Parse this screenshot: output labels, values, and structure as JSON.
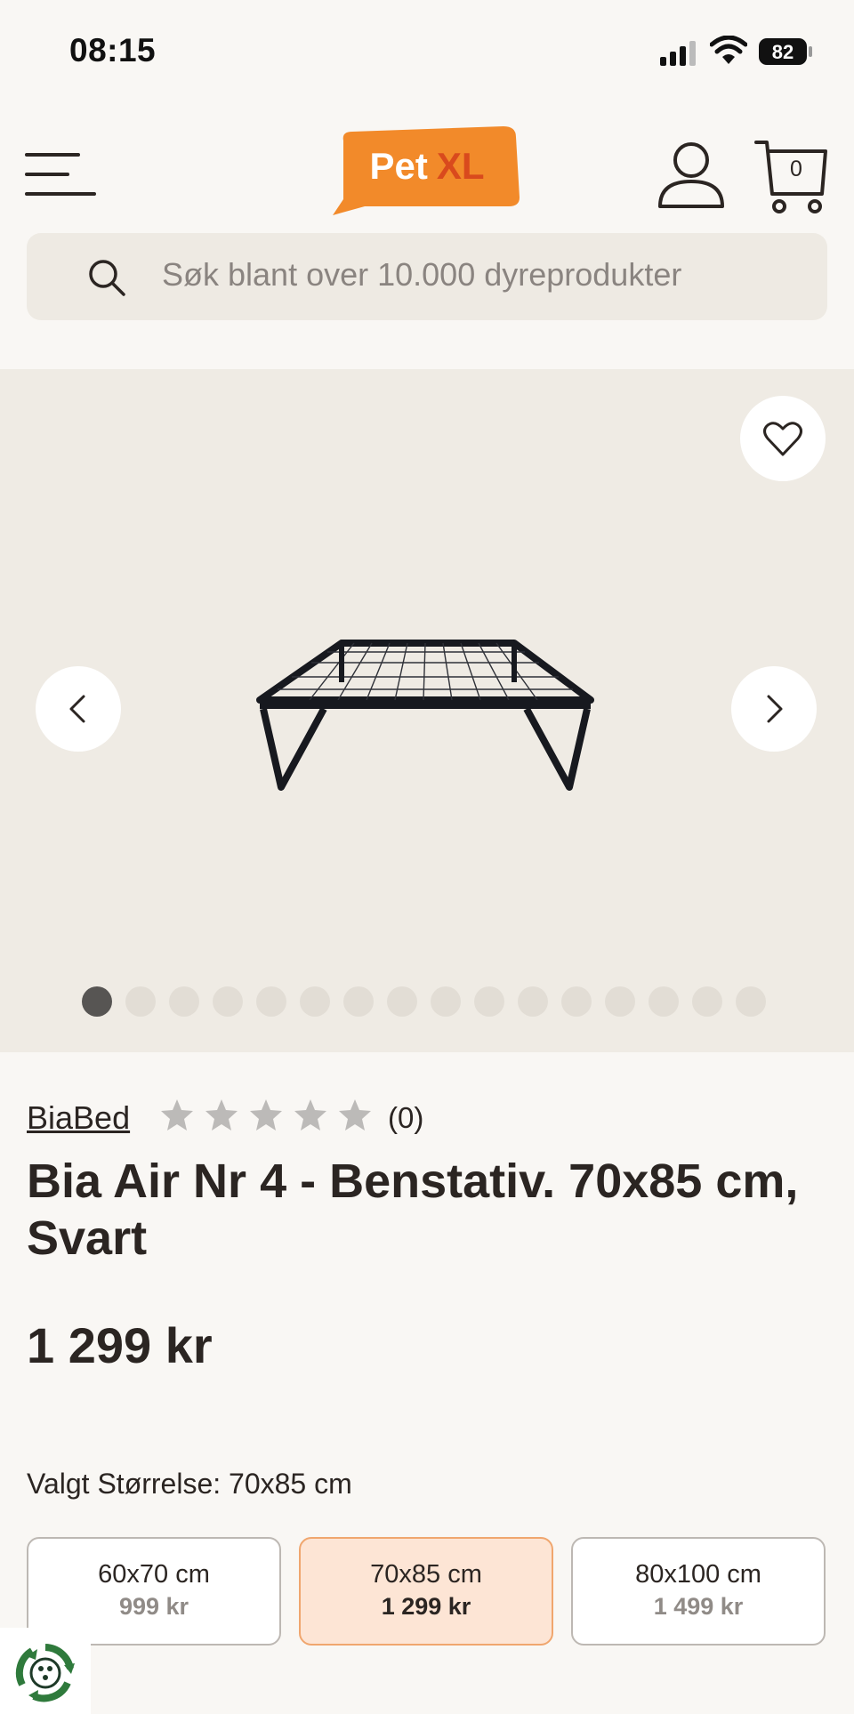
{
  "status_bar": {
    "time": "08:15",
    "battery": "82"
  },
  "header": {
    "logo": {
      "word1": "Pet",
      "word2": "XL"
    },
    "cart_count": "0",
    "search_placeholder": "Søk blant over 10.000 dyreprodukter"
  },
  "gallery": {
    "image_count": 16,
    "active_index": 0
  },
  "product": {
    "brand": "BiaBed",
    "rating": 0,
    "rating_count": "(0)",
    "title": "Bia Air Nr 4 - Benstativ. 70x85 cm, Svart",
    "price": "1 299 kr"
  },
  "size": {
    "label": "Valgt Størrelse: 70x85 cm",
    "options": [
      {
        "name": "60x70 cm",
        "price": "999 kr",
        "selected": false
      },
      {
        "name": "70x85 cm",
        "price": "1 299 kr",
        "selected": true
      },
      {
        "name": "80x100 cm",
        "price": "1 499 kr",
        "selected": false
      }
    ]
  },
  "colors": {
    "brand_orange": "#f28a2a",
    "logo_xl": "#d94a1d",
    "selected_bg": "#fde5d5",
    "selected_border": "#f0a66e",
    "eco_green": "#2f7a3c"
  },
  "icons": [
    "signal-icon",
    "wifi-icon",
    "battery-icon",
    "menu-icon",
    "account-icon",
    "cart-icon",
    "search-icon",
    "heart-icon",
    "chevron-left-icon",
    "chevron-right-icon",
    "star-icon",
    "recycle-icon"
  ]
}
